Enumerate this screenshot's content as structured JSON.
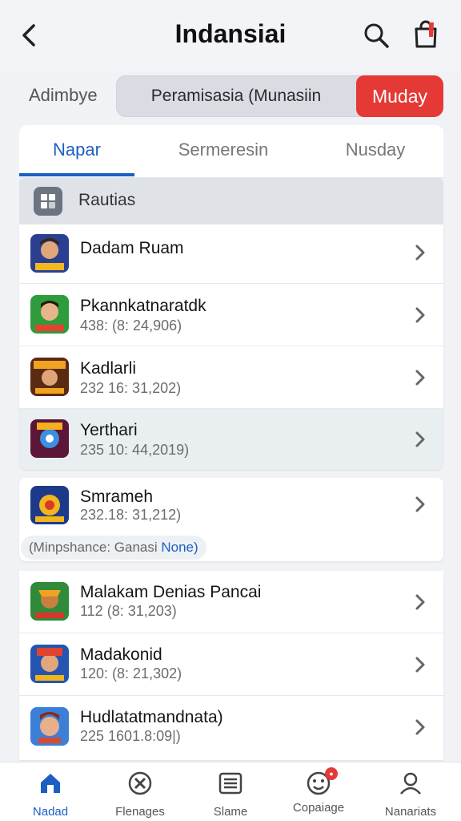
{
  "header": {
    "title": "Indansiai",
    "back_icon": "chevron-left-icon",
    "search_icon": "search-icon",
    "bag_icon": "shopping-bag-icon"
  },
  "filter": {
    "label": "Adimbye",
    "option_a": "Peramisasia (Munasiin",
    "option_b": "Muday",
    "accent_color": "#e53935"
  },
  "tabs": [
    {
      "label": "Napar",
      "active": true
    },
    {
      "label": "Sermeresin",
      "active": false
    },
    {
      "label": "Nusday",
      "active": false
    }
  ],
  "section": {
    "label": "Rautias",
    "icon": "grid-icon"
  },
  "group1": [
    {
      "name": "Dadam Ruam",
      "meta": "",
      "highlight": false
    },
    {
      "name": "Pkannkatnaratdk",
      "meta": "438: (8: 24,906)",
      "highlight": false
    },
    {
      "name": "Kadlarli",
      "meta": "232 16: 31,202)",
      "highlight": false
    },
    {
      "name": "Yerthari",
      "meta": "235 10: 44,2019)",
      "highlight": true
    }
  ],
  "group2": {
    "item": {
      "name": "Smrameh",
      "meta": "232.18: 31,212)"
    },
    "pill_text": "(Minpshance: Ganasi ",
    "pill_accent": "None)"
  },
  "group3": [
    {
      "name": "Malakam Denias Pancai",
      "meta": "112 (8: 31,203)"
    },
    {
      "name": "Madakonid",
      "meta": "120: (8: 21,302)"
    },
    {
      "name": "Hudlatatmandnata)",
      "meta": "225 1601.8:09|)"
    }
  ],
  "bottom_nav": [
    {
      "label": "Nadad",
      "icon": "home-icon",
      "active": true
    },
    {
      "label": "Flenages",
      "icon": "tools-icon",
      "active": false
    },
    {
      "label": "Slame",
      "icon": "list-icon",
      "active": false
    },
    {
      "label": "Copaiage",
      "icon": "emoji-icon",
      "active": false,
      "badge": true
    },
    {
      "label": "Nanariats",
      "icon": "user-icon",
      "active": false
    }
  ],
  "colors": {
    "primary": "#1b5fc4",
    "accent": "#e53935"
  }
}
